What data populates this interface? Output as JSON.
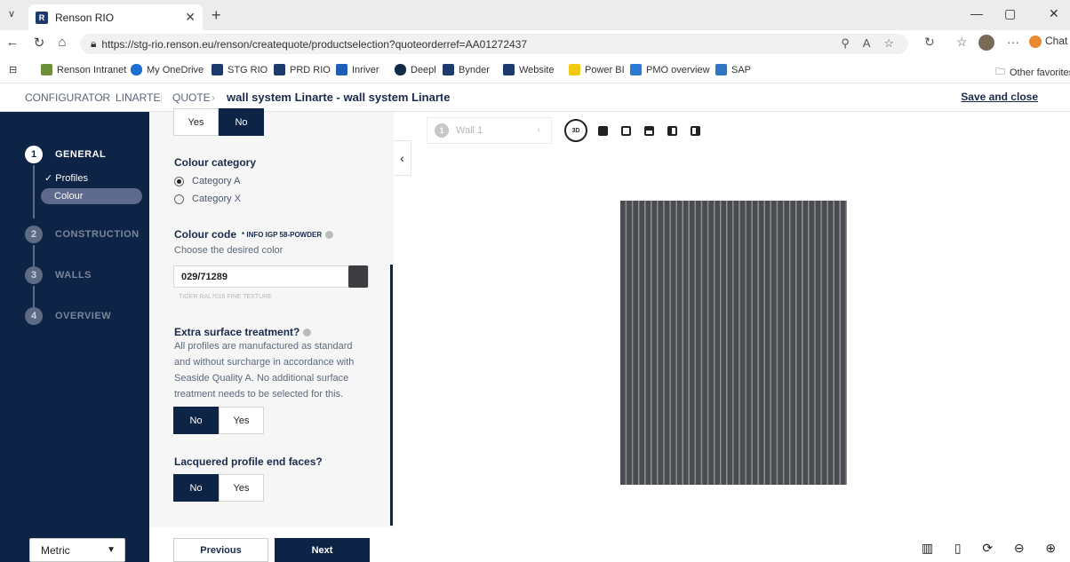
{
  "browser": {
    "tab_title": "Renson RIO",
    "url": "https://stg-rio.renson.eu/renson/createquote/productselection?quoteorderref=AA01272437",
    "chat_label": "Chat"
  },
  "bookmarks": [
    {
      "label": "Renson Intranet",
      "color": "#6d8f3a"
    },
    {
      "label": "My OneDrive",
      "color": "#1d6fd1"
    },
    {
      "label": "STG RIO",
      "color": "#1d3a6e"
    },
    {
      "label": "PRD RIO",
      "color": "#1d3a6e"
    },
    {
      "label": "Inriver",
      "color": "#1d5fb8"
    },
    {
      "label": "Deepl",
      "color": "#0f2b46"
    },
    {
      "label": "Bynder",
      "color": "#1d3a6e"
    },
    {
      "label": "Website",
      "color": "#1d3a6e"
    },
    {
      "label": "Power BI",
      "color": "#f2c811"
    },
    {
      "label": "PMO overview",
      "color": "#2b7bd6"
    },
    {
      "label": "SAP",
      "color": "#2d77c2"
    }
  ],
  "other_favorites": "Other favorites",
  "header": {
    "crumb1": "CONFIGURATOR",
    "crumb2": "LINARTE",
    "crumb3": "QUOTE",
    "title": "wall system Linarte - wall system Linarte",
    "save": "Save and close"
  },
  "steps": [
    {
      "num": "1",
      "label": "GENERAL"
    },
    {
      "num": "2",
      "label": "CONSTRUCTION"
    },
    {
      "num": "3",
      "label": "WALLS"
    },
    {
      "num": "4",
      "label": "OVERVIEW"
    }
  ],
  "substeps": {
    "profiles": "✓ Profiles",
    "colour": "Colour"
  },
  "unit_select": "Metric",
  "form": {
    "top_toggle": {
      "yes": "Yes",
      "no": "No"
    },
    "colour_category": "Colour category",
    "cat_a": "Category A",
    "cat_b": "Category X",
    "colour_code": "Colour code",
    "info": "* INFO IGP 58-POWDER",
    "choose": "Choose the desired color",
    "code_value": "029/71289",
    "code_hint": "TIGER RAL7016 FINE TEXTURE",
    "extra_title": "Extra surface treatment?",
    "extra_desc": "All profiles are manufactured as standard and without surcharge in accordance with Seaside Quality A. No additional surface treatment needs to be selected for this.",
    "extra_no": "No",
    "extra_yes": "Yes",
    "lacquer_title": "Lacquered profile end faces?",
    "lacquer_no": "No",
    "lacquer_yes": "Yes"
  },
  "footer": {
    "previous": "Previous",
    "next": "Next"
  },
  "viewer": {
    "wall_num": "1",
    "wall_label": "Wall 1",
    "view_3d": "3D",
    "wall_color": "#4a4c51",
    "slat_count": 36
  }
}
